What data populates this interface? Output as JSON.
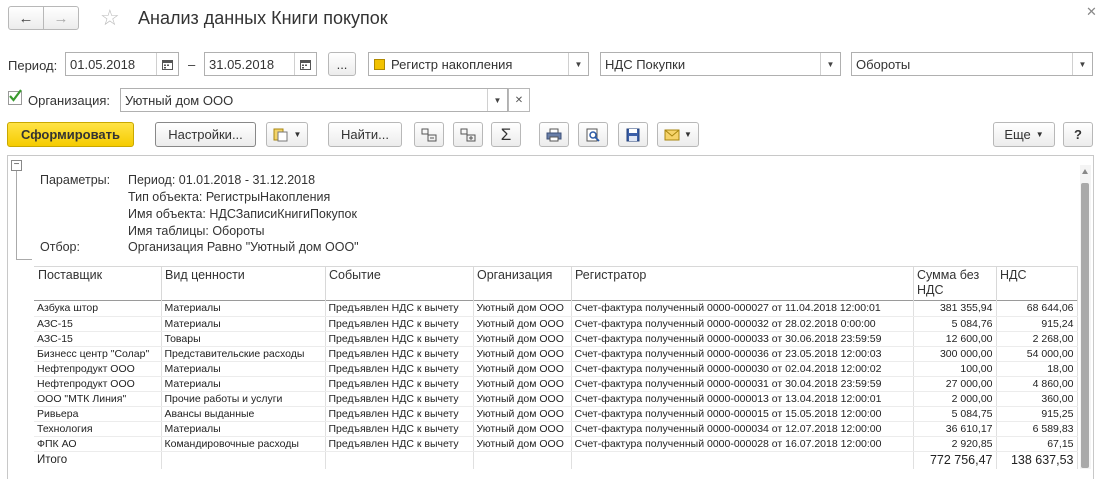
{
  "window": {
    "title": "Анализ данных Книги покупок"
  },
  "filters": {
    "period_label": "Период:",
    "date_from": "01.05.2018",
    "dash": "–",
    "date_to": "31.05.2018",
    "dots": "...",
    "object_type": "Регистр накопления",
    "object_name": "НДС Покупки",
    "table_name": "Обороты",
    "org_label": "Организация:",
    "org_value": "Уютный дом ООО"
  },
  "toolbar": {
    "generate": "Сформировать",
    "settings": "Настройки...",
    "find": "Найти...",
    "sum": "Σ",
    "more": "Еще",
    "help": "?"
  },
  "params": {
    "label": "Параметры:",
    "period": "Период: 01.01.2018 - 31.12.2018",
    "object_type": "Тип объекта: РегистрыНакопления",
    "object_name": "Имя объекта: НДСЗаписиКнигиПокупок",
    "table_name": "Имя таблицы: Обороты",
    "filter_label": "Отбор:",
    "filter": "Организация Равно \"Уютный дом ООО\""
  },
  "table": {
    "headers": [
      "Поставщик",
      "Вид ценности",
      "Событие",
      "Организация",
      "Регистратор",
      "Сумма без НДС",
      "НДС"
    ],
    "rows": [
      [
        "Азбука штор",
        "Материалы",
        "Предъявлен НДС к вычету",
        "Уютный дом ООО",
        "Счет-фактура полученный 0000-000027 от 11.04.2018 12:00:01",
        "381 355,94",
        "68 644,06"
      ],
      [
        "АЗС-15",
        "Материалы",
        "Предъявлен НДС к вычету",
        "Уютный дом ООО",
        "Счет-фактура полученный 0000-000032 от 28.02.2018 0:00:00",
        "5 084,76",
        "915,24"
      ],
      [
        "АЗС-15",
        "Товары",
        "Предъявлен НДС к вычету",
        "Уютный дом ООО",
        "Счет-фактура полученный 0000-000033 от 30.06.2018 23:59:59",
        "12 600,00",
        "2 268,00"
      ],
      [
        "Бизнесс центр \"Солар\"",
        "Представительские расходы",
        "Предъявлен НДС к вычету",
        "Уютный дом ООО",
        "Счет-фактура полученный 0000-000036 от 23.05.2018 12:00:03",
        "300 000,00",
        "54 000,00"
      ],
      [
        "Нефтепродукт ООО",
        "Материалы",
        "Предъявлен НДС к вычету",
        "Уютный дом ООО",
        "Счет-фактура полученный 0000-000030 от 02.04.2018 12:00:02",
        "100,00",
        "18,00"
      ],
      [
        "Нефтепродукт ООО",
        "Материалы",
        "Предъявлен НДС к вычету",
        "Уютный дом ООО",
        "Счет-фактура полученный 0000-000031 от 30.04.2018 23:59:59",
        "27 000,00",
        "4 860,00"
      ],
      [
        "ООО \"МТК Линия\"",
        "Прочие работы и услуги",
        "Предъявлен НДС к вычету",
        "Уютный дом ООО",
        "Счет-фактура полученный 0000-000013 от 13.04.2018 12:00:01",
        "2 000,00",
        "360,00"
      ],
      [
        "Ривьера",
        "Авансы выданные",
        "Предъявлен НДС к вычету",
        "Уютный дом ООО",
        "Счет-фактура полученный 0000-000015 от 15.05.2018 12:00:00",
        "5 084,75",
        "915,25"
      ],
      [
        "Технология",
        "Материалы",
        "Предъявлен НДС к вычету",
        "Уютный дом ООО",
        "Счет-фактура полученный 0000-000034 от 12.07.2018 12:00:00",
        "36 610,17",
        "6 589,83"
      ],
      [
        "ФПК АО",
        "Командировочные расходы",
        "Предъявлен НДС к вычету",
        "Уютный дом ООО",
        "Счет-фактура полученный 0000-000028 от 16.07.2018 12:00:00",
        "2 920,85",
        "67,15"
      ]
    ],
    "total_label": "Итого",
    "total_sum": "772 756,47",
    "total_vat": "138 637,53"
  }
}
